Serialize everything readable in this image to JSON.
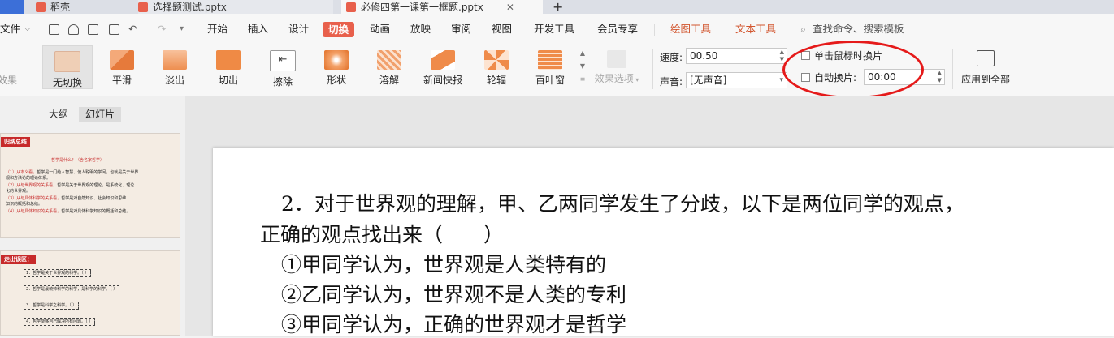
{
  "tabs": [
    {
      "label": "稻壳",
      "icon": "wps-docer-icon"
    },
    {
      "label": "选择题测试.pptx",
      "icon": "pptx-file-icon"
    },
    {
      "label": "必修四第一课第一框题.pptx",
      "icon": "pptx-file-icon",
      "active": true
    }
  ],
  "new_tab_label": "+",
  "menu": {
    "file": "文件",
    "items": [
      "开始",
      "插入",
      "设计",
      "切换",
      "动画",
      "放映",
      "审阅",
      "视图",
      "开发工具",
      "会员专享"
    ],
    "active": "切换",
    "context": [
      "绘图工具",
      "文本工具"
    ],
    "search_placeholder": "查找命令、搜索模板"
  },
  "ribbon": {
    "effects_label": "效果",
    "transitions": [
      "无切换",
      "平滑",
      "淡出",
      "切出",
      "擦除",
      "形状",
      "溶解",
      "新闻快报",
      "轮辐",
      "百叶窗"
    ],
    "selected": "无切换",
    "effect_options_label": "效果选项",
    "speed_label": "速度:",
    "speed_value": "00.50",
    "sound_label": "声音:",
    "sound_value": "[无声音]",
    "on_click_label": "单击鼠标时换片",
    "auto_label": "自动换片:",
    "auto_value": "00:00",
    "apply_all_label": "应用到全部"
  },
  "panel": {
    "tabs": [
      "大纲",
      "幻灯片"
    ],
    "active": "幻灯片"
  },
  "thumbnails": [
    {
      "tag": "归纳总结",
      "title": "哲学是什么？（含名家哲学）",
      "lines": [
        {
          "em": "（1）从本义看，",
          "rest": "哲学是一门给人智慧、使人聪明的学问，也就是关于世界"
        },
        {
          "em": "",
          "rest": "观和方法论的理论体系。"
        },
        {
          "em": "（2）从与世界观的关系看，",
          "rest": "哲学是关于世界观的理论，是系统化、理论"
        },
        {
          "em": "",
          "rest": "化的世界观。"
        },
        {
          "em": "（3）从与具体科学的关系看，",
          "rest": "哲学是对自然知识、社会知识和思维"
        },
        {
          "em": "",
          "rest": "知识的概括和总结。"
        },
        {
          "em": "（4）从与具体知识的关系看，",
          "rest": "哲学是对具体科学知识的概括和总结。"
        }
      ]
    },
    {
      "tag": "走出误区：",
      "lines": [
        {
          "em": "",
          "rest": "1．哲学是关于世界观的科学。（   ）"
        },
        {
          "em": "",
          "rest": "2．哲学是最统帅科学的科学，是科学的科学。（   ）"
        },
        {
          "em": "",
          "rest": "3．哲学是科学之科学。（   ）"
        },
        {
          "em": "",
          "rest": "4．哲学能够自己解决所有问题。（   ）"
        }
      ]
    }
  ],
  "slide": {
    "lines": [
      "2．对于世界观的理解，甲、乙两同学发生了分歧，以下是两位同学的观点，",
      "正确的观点找出来（　　）",
      "①甲同学认为，世界观是人类特有的",
      "②乙同学认为，世界观不是人类的专利",
      "③甲同学认为，正确的世界观才是哲学"
    ]
  },
  "colors": {
    "accent": "#e8604c",
    "context_tab": "#d2552e",
    "annotation_circle": "#e51a1a"
  }
}
